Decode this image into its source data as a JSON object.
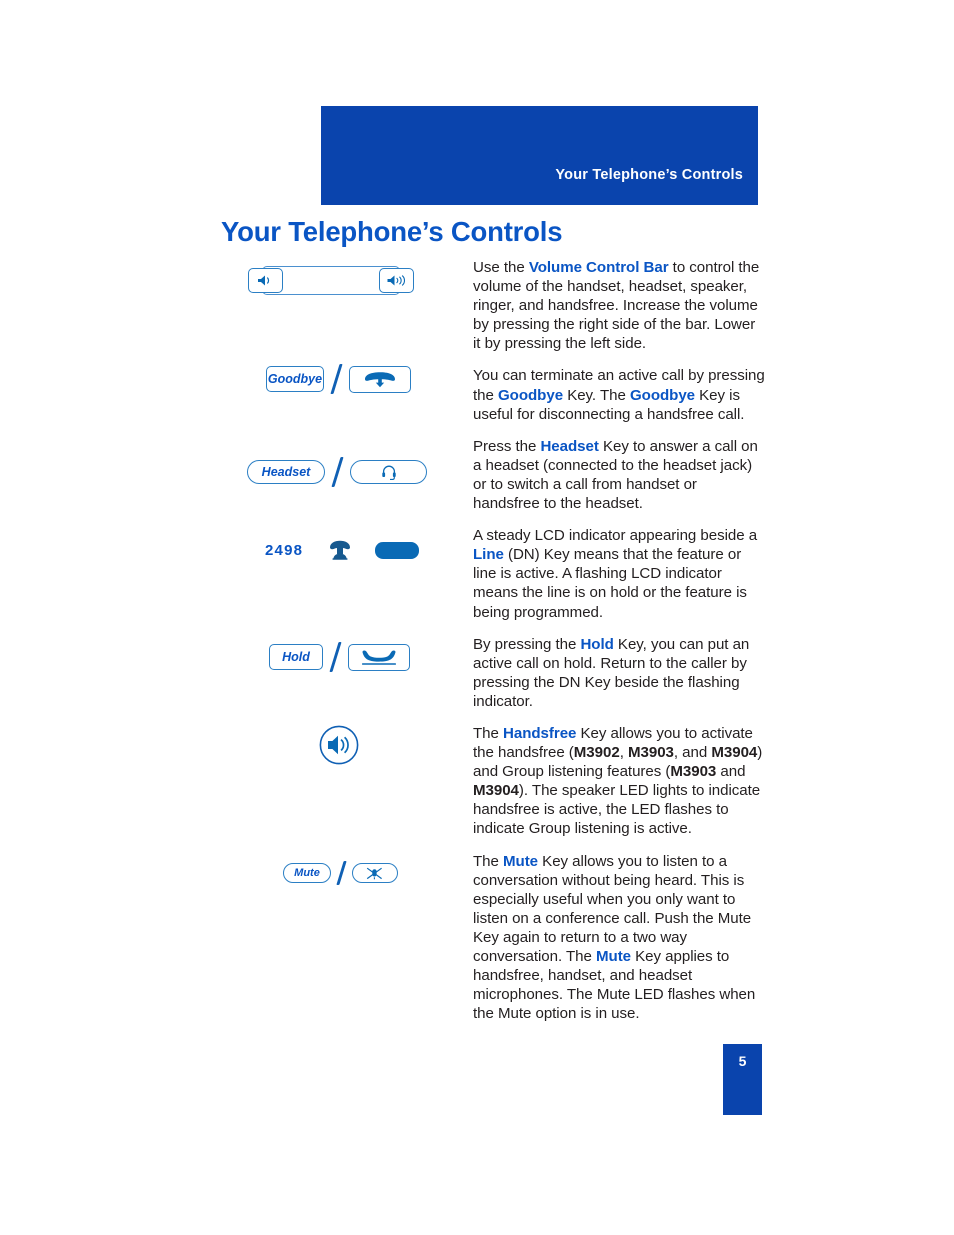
{
  "header": {
    "running_title": "Your Telephone’s Controls"
  },
  "page_title": "Your Telephone’s Controls",
  "keys": {
    "volume_left_icon": "speaker-low-icon",
    "volume_right_icon": "speaker-high-icon",
    "goodbye_label": "Goodbye",
    "goodbye_icon": "handset-down-arrow-icon",
    "headset_label": "Headset",
    "headset_icon": "headset-icon",
    "line_number": "2498",
    "line_icon": "telephone-icon",
    "line_lamp": "lcd-indicator-lamp",
    "hold_label": "Hold",
    "hold_icon": "handset-cradled-icon",
    "handsfree_icon": "speaker-circle-icon",
    "mute_label": "Mute",
    "mute_icon": "microphone-muted-icon"
  },
  "paragraphs": {
    "volume": {
      "a": "Use the ",
      "kw1": "Volume Control Bar",
      "b": " to control the volume of the handset, headset, speaker, ringer, and handsfree. Increase the volume by pressing the right side of the bar. Lower it by pressing the left side."
    },
    "goodbye": {
      "a": "You can terminate an active call by pressing the ",
      "kw1": "Goodbye",
      "b": " Key. The ",
      "kw2": "Goodbye",
      "c": " Key is useful for disconnecting a handsfree call."
    },
    "headset": {
      "a": "Press the ",
      "kw1": "Headset",
      "b": " Key to answer a call on a headset (connected to the headset jack) or to switch a call from handset or handsfree to the headset."
    },
    "line": {
      "a": "A steady LCD indicator appearing beside a ",
      "kw1": "Line",
      "b": " (DN) Key means that the feature or line is active. A flashing LCD indicator means the line is on hold or the feature is being programmed."
    },
    "hold": {
      "a": "By pressing the ",
      "kw1": "Hold",
      "b": " Key, you can put an active call on hold. Return to the caller by pressing the DN Key beside the flashing indicator."
    },
    "handsfree": {
      "a": "The ",
      "kw1": "Handsfree",
      "b": " Key allows you to activate the handsfree (",
      "m1": "M3902",
      "c": ", ",
      "m2": "M3903",
      "d": ", and ",
      "m3": "M3904",
      "e": ") and Group listening features (",
      "m4": "M3903",
      "f": " and ",
      "m5": "M3904",
      "g": "). The speaker LED lights to indicate handsfree is active, the LED flashes to indicate Group listening is active."
    },
    "mute": {
      "a": "The ",
      "kw1": "Mute",
      "b": " Key allows you to listen to a conversation without being heard. This is especially useful when you only want to listen on a conference call. Push the Mute Key again to return to a two way conversation. The ",
      "kw2": "Mute",
      "c": " Key applies to handsfree, handset, and headset microphones. The Mute LED flashes when the Mute option is in use."
    }
  },
  "page_number": "5",
  "colors": {
    "brand_blue": "#0a44ad",
    "link_blue": "#0a55c4",
    "icon_blue": "#0a6ab5",
    "body_black": "#231f20"
  }
}
